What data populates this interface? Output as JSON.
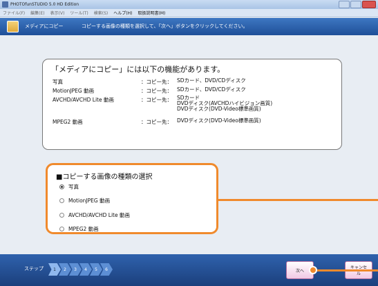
{
  "window": {
    "title": "PHOTOfunSTUDIO 5.0 HD Edition"
  },
  "menubar": {
    "items": [
      "ファイル(F)",
      "編集(E)",
      "表示(V)",
      "ツール(T)",
      "検索(S)",
      "ヘルプ(H)",
      "取扱説明書(M)"
    ]
  },
  "toolbar": {
    "title": "メディアにコピー",
    "instruction": "コピーする画像の種類を選択して、「次へ」ボタンをクリックしてください。"
  },
  "info": {
    "heading": "「メディアにコピー」には以下の機能があります。",
    "copy_dest_label": "：コピー先：",
    "rows": [
      {
        "type": "写真",
        "dest": [
          "SDカード、DVD/CDディスク"
        ]
      },
      {
        "type": "MotionJPEG 動画",
        "dest": [
          "SDカード、DVD/CDディスク"
        ]
      },
      {
        "type": "AVCHD/AVCHD Lite 動画",
        "dest": [
          "SDカード",
          "DVDディスク(AVCHDハイビジョン画質)",
          "DVDディスク(DVD-Video標準画質)"
        ]
      },
      {
        "type": "MPEG2 動画",
        "dest": [
          "DVDディスク(DVD-Video標準画質)"
        ]
      }
    ]
  },
  "selection": {
    "heading": "■コピーする画像の種類の選択",
    "options": [
      "写真",
      "MotionJPEG 動画",
      "AVCHD/AVCHD Lite 動画",
      "MPEG2 動画"
    ],
    "selected_index": 0
  },
  "footer": {
    "step_label": "ステップ",
    "steps": [
      "1",
      "2",
      "3",
      "4",
      "5",
      "6"
    ],
    "current_step": 1,
    "next_label": "次へ",
    "cancel_label": "キャンセル"
  },
  "colors": {
    "accent": "#f08a2c",
    "toolbar_blue": "#2a5fab"
  }
}
